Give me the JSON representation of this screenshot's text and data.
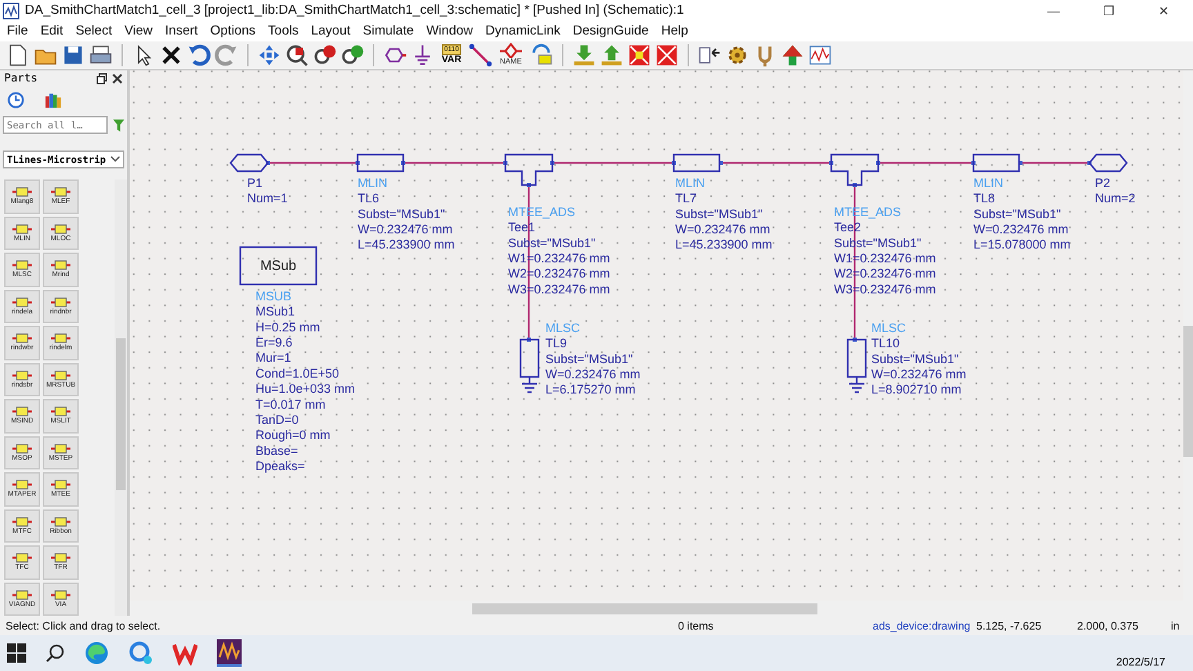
{
  "window": {
    "title": "DA_SmithChartMatch1_cell_3 [project1_lib:DA_SmithChartMatch1_cell_3:schematic] * [Pushed In] (Schematic):1",
    "controls": [
      "—",
      "❐",
      "✕"
    ]
  },
  "menu": [
    "File",
    "Edit",
    "Select",
    "View",
    "Insert",
    "Options",
    "Tools",
    "Layout",
    "Simulate",
    "Window",
    "DynamicLink",
    "DesignGuide",
    "Help"
  ],
  "toolbar": [
    {
      "kind": "new"
    },
    {
      "kind": "open"
    },
    {
      "kind": "save"
    },
    {
      "kind": "print"
    },
    {
      "kind": "sep"
    },
    {
      "kind": "pointer"
    },
    {
      "kind": "delete"
    },
    {
      "kind": "undo"
    },
    {
      "kind": "redo"
    },
    {
      "kind": "sep"
    },
    {
      "kind": "move"
    },
    {
      "kind": "zoom-area"
    },
    {
      "kind": "zoom-in"
    },
    {
      "kind": "zoom-out"
    },
    {
      "kind": "sep"
    },
    {
      "kind": "port"
    },
    {
      "kind": "ground"
    },
    {
      "kind": "var",
      "labels": [
        "0110",
        "VAR"
      ]
    },
    {
      "kind": "wire"
    },
    {
      "kind": "name",
      "labels": [
        "NAME"
      ]
    },
    {
      "kind": "swap"
    },
    {
      "kind": "sep"
    },
    {
      "kind": "push"
    },
    {
      "kind": "pop"
    },
    {
      "kind": "deactivate"
    },
    {
      "kind": "short"
    },
    {
      "kind": "sep"
    },
    {
      "kind": "back"
    },
    {
      "kind": "gear"
    },
    {
      "kind": "tune"
    },
    {
      "kind": "up"
    },
    {
      "kind": "graph"
    }
  ],
  "parts": {
    "title": "Parts",
    "search": {
      "placeholder": "Search all l…"
    },
    "library": "TLines-Microstrip",
    "items": [
      "Mlang8",
      "MLEF",
      "MLIN",
      "MLOC",
      "MLSC",
      "Mrind",
      "rindela",
      "rindnbr",
      "rindwbr",
      "rindelm",
      "rindsbr",
      "MRSTUB",
      "MSIND",
      "MSLIT",
      "MSOP",
      "MSTEP",
      "MTAPER",
      "MTEE",
      "MTFC",
      "Ribbon",
      "TFC",
      "TFR",
      "VIAGND",
      "VIA"
    ]
  },
  "schematic": {
    "components": [
      {
        "kind": "port",
        "name": "P1",
        "params": [
          "Num=1"
        ]
      },
      {
        "kind": "mlin",
        "type": "MLIN",
        "name": "TL6",
        "params": [
          "Subst=\"MSub1\"",
          "W=0.232476 mm",
          "L=45.233900 mm"
        ]
      },
      {
        "kind": "tee",
        "type": "MTEE_ADS",
        "name": "Tee1",
        "params": [
          "Subst=\"MSub1\"",
          "W1=0.232476 mm",
          "W2=0.232476 mm",
          "W3=0.232476 mm"
        ]
      },
      {
        "kind": "mlin",
        "type": "MLIN",
        "name": "TL7",
        "params": [
          "Subst=\"MSub1\"",
          "W=0.232476 mm",
          "L=45.233900 mm"
        ]
      },
      {
        "kind": "tee",
        "type": "MTEE_ADS",
        "name": "Tee2",
        "params": [
          "Subst=\"MSub1\"",
          "W1=0.232476 mm",
          "W2=0.232476 mm",
          "W3=0.232476 mm"
        ]
      },
      {
        "kind": "mlin",
        "type": "MLIN",
        "name": "TL8",
        "params": [
          "Subst=\"MSub1\"",
          "W=0.232476 mm",
          "L=15.078000 mm"
        ]
      },
      {
        "kind": "port",
        "name": "P2",
        "params": [
          "Num=2"
        ]
      },
      {
        "kind": "msub",
        "symbol_label": "MSub",
        "type": "MSUB",
        "name": "MSub1",
        "params": [
          "H=0.25 mm",
          "Er=9.6",
          "Mur=1",
          "Cond=1.0E+50",
          "Hu=1.0e+033 mm",
          "T=0.017 mm",
          "TanD=0",
          "Rough=0 mm",
          "Bbase=",
          "Dpeaks="
        ]
      },
      {
        "kind": "mlsc",
        "type": "MLSC",
        "name": "TL9",
        "params": [
          "Subst=\"MSub1\"",
          "W=0.232476 mm",
          "L=6.175270 mm"
        ]
      },
      {
        "kind": "mlsc",
        "type": "MLSC",
        "name": "TL10",
        "params": [
          "Subst=\"MSub1\"",
          "W=0.232476 mm",
          "L=8.902710 mm"
        ]
      }
    ]
  },
  "status_bar": {
    "message": "Select: Click and drag to select.",
    "items": "0 items",
    "layer": "ads_device:drawing",
    "position": "5.125, -7.625",
    "snap": "2.000, 0.375",
    "units": "in"
  },
  "taskbar": {
    "date": "2022/5/17"
  }
}
